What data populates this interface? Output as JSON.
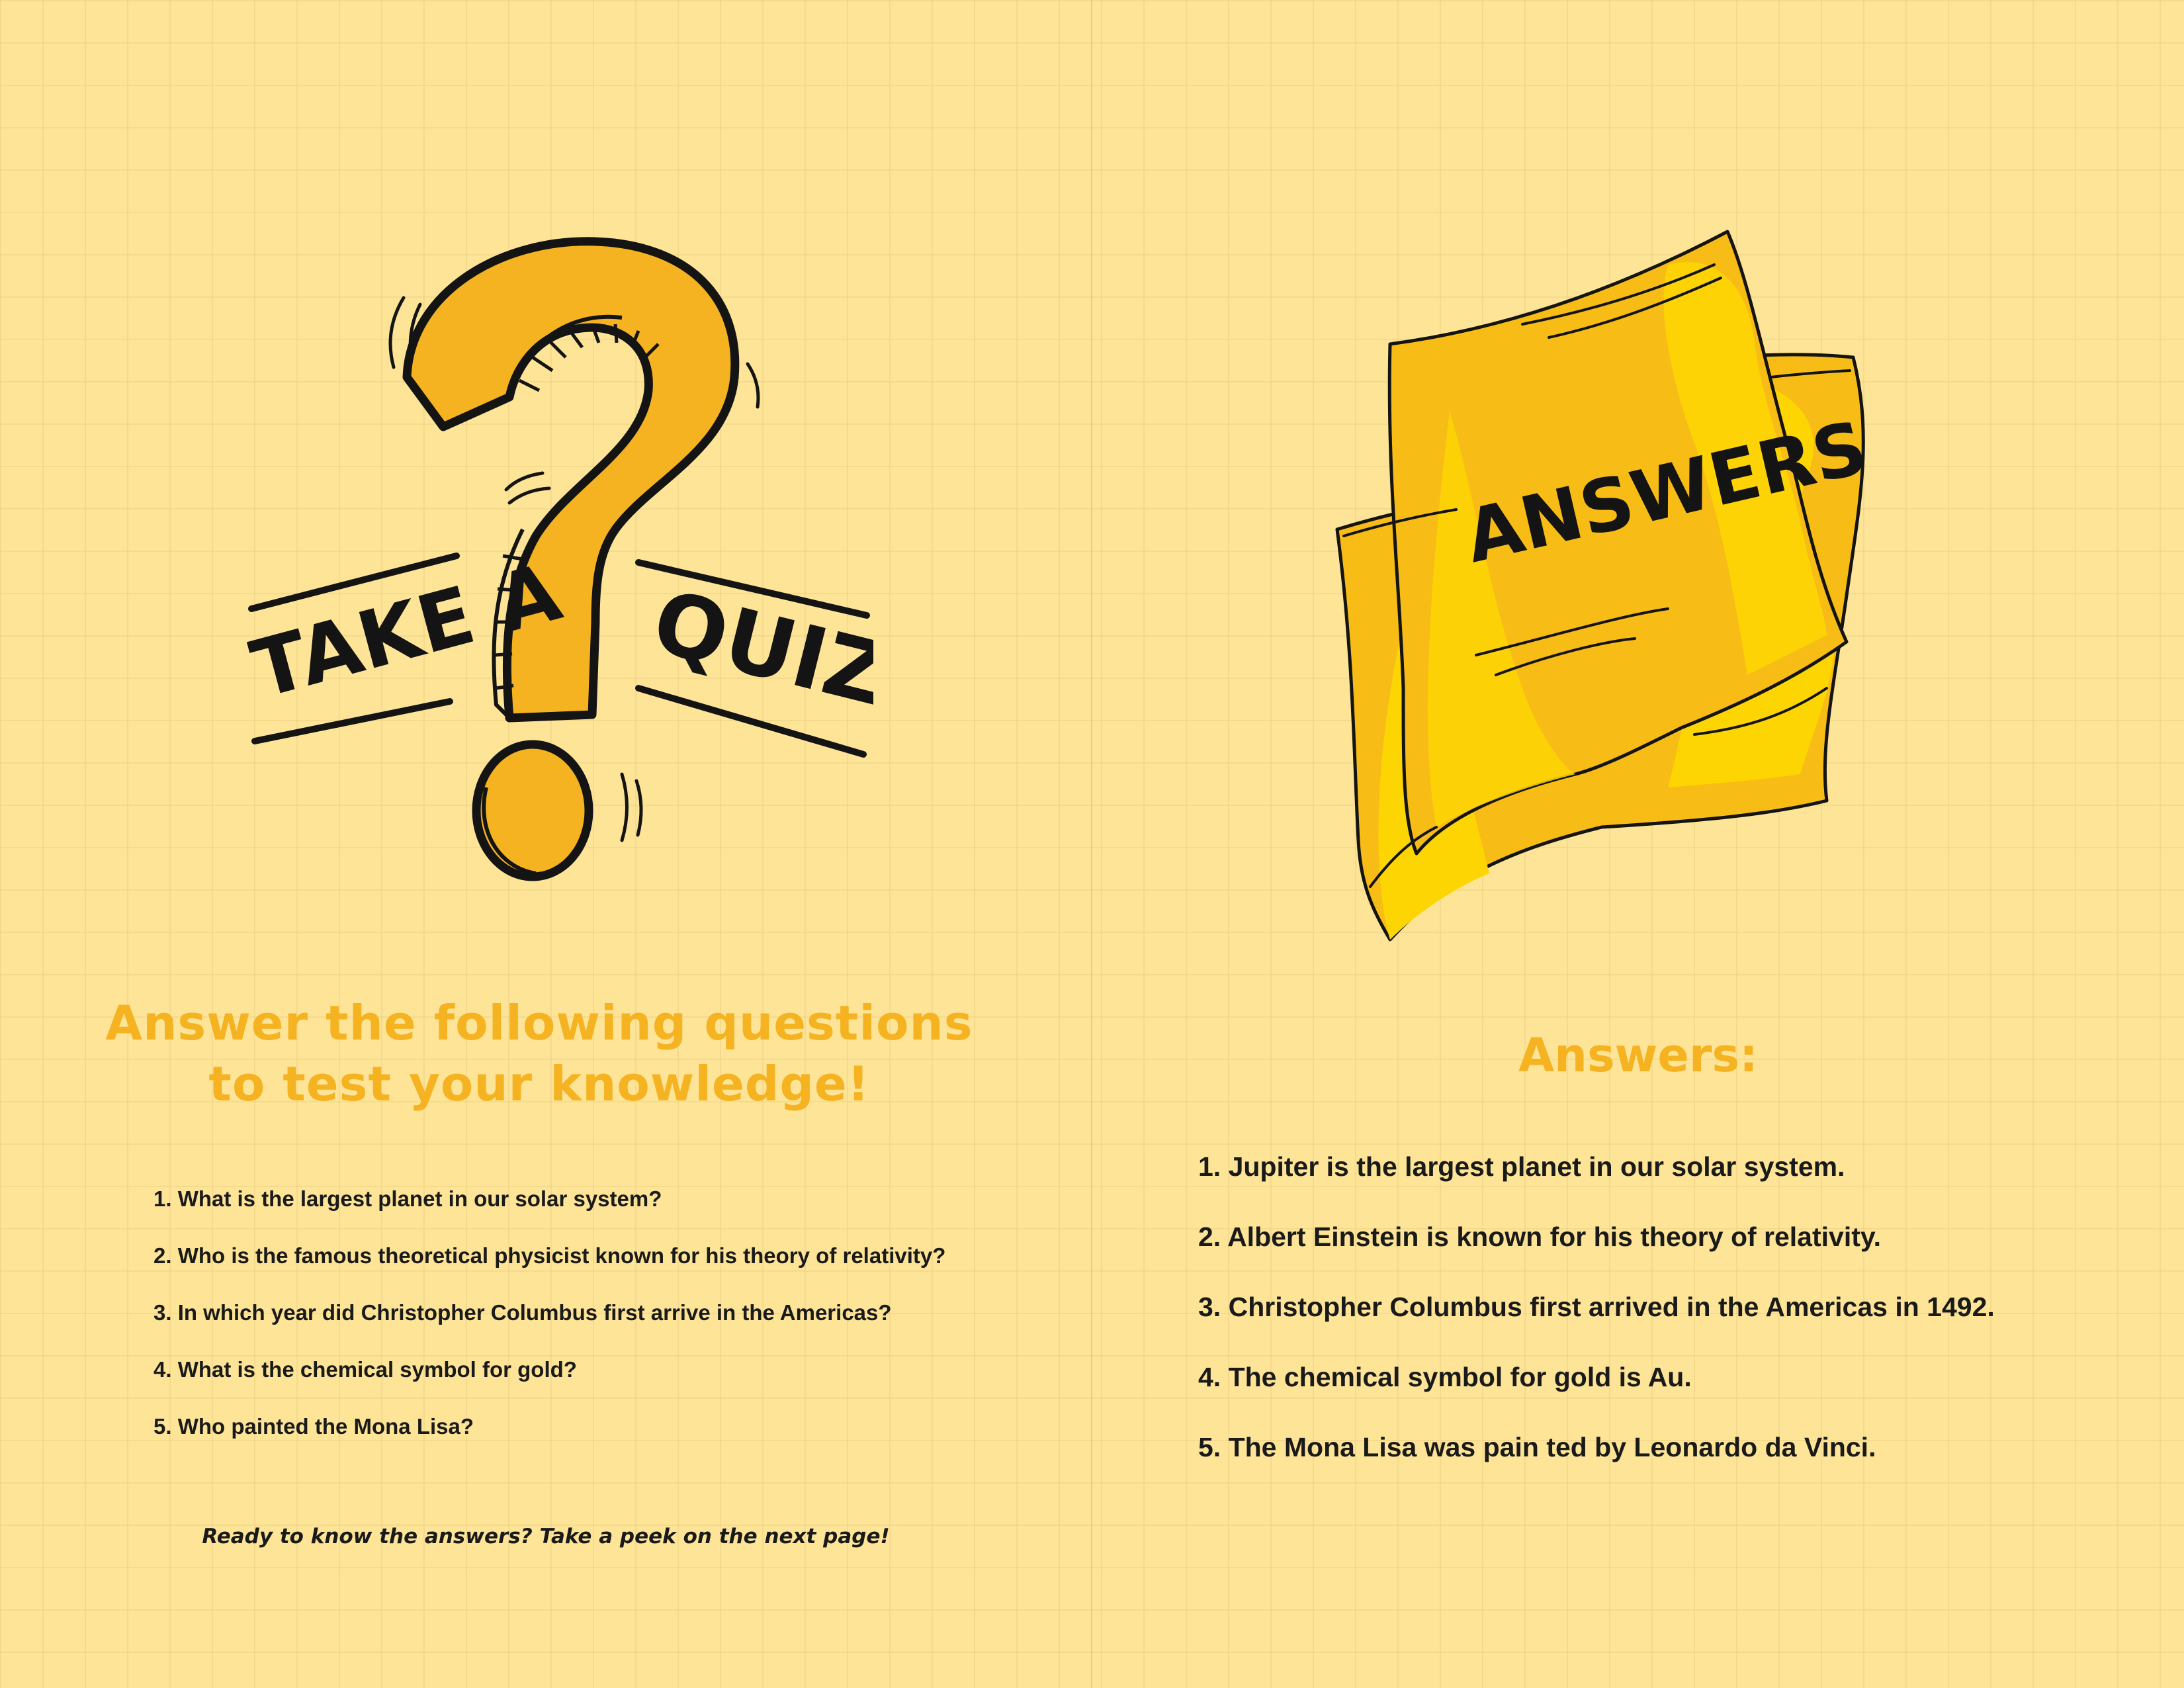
{
  "quiz_page": {
    "illustration": {
      "icon": "question-mark-icon",
      "left_word": "TAKE A",
      "right_word": "QUIZ"
    },
    "heading_line1": "Answer the following questions",
    "heading_line2": "to test your knowledge!",
    "questions": [
      "1. What is the largest planet in our solar system?",
      "2. Who is the famous theoretical physicist known for his theory of relativity?",
      "3. In which year did Christopher Columbus first arrive in the Americas?",
      "4. What is the chemical symbol for gold?",
      "5. Who painted the Mona Lisa?"
    ],
    "footer_note": "Ready to know the answers? Take a peek on the next page!"
  },
  "answers_page": {
    "illustration": {
      "icon": "paper-sheets-icon",
      "label": "ANSWERS"
    },
    "heading": "Answers:",
    "answers": [
      "1. Jupiter is the largest planet in our solar system.",
      "2. Albert Einstein is known for his theory of relativity.",
      "3. Christopher Columbus first arrived in the Americas in 1492.",
      "4. The chemical symbol for gold is Au.",
      "5. The Mona Lisa was pain ted by Leonardo da Vinci."
    ]
  },
  "colors": {
    "background": "#fde497",
    "accent": "#f5b321",
    "paper": "#f8bc16",
    "paper_highlight": "#fdd503",
    "ink": "#141414"
  }
}
